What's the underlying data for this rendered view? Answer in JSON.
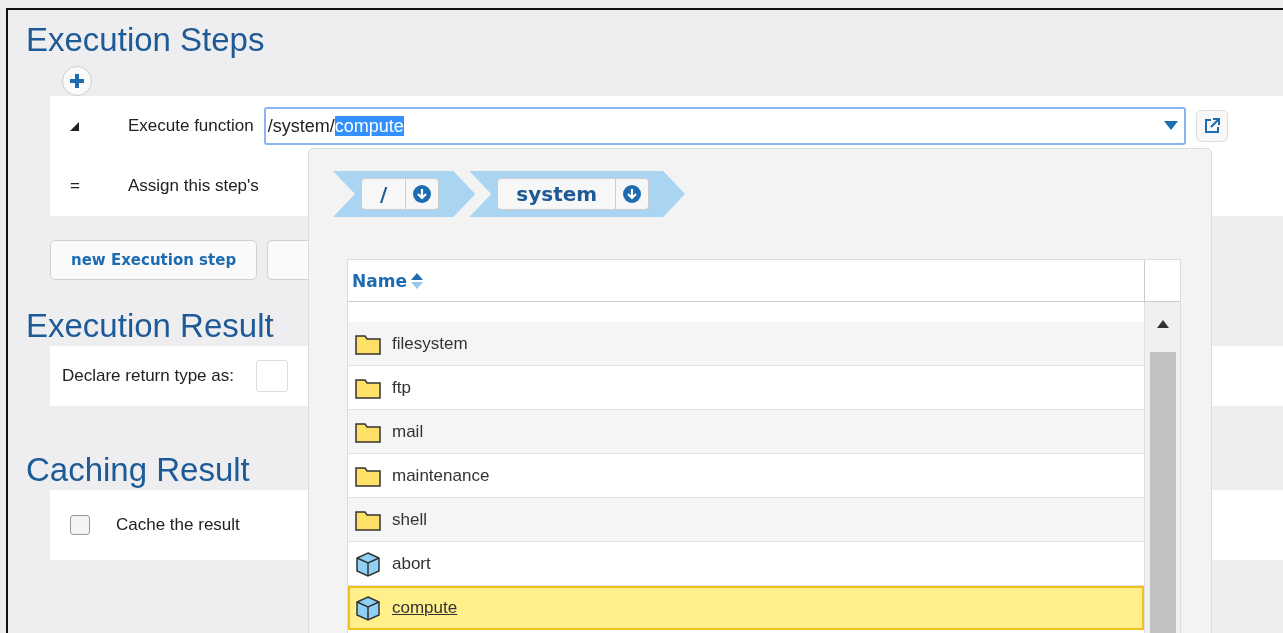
{
  "execution_steps": {
    "title": "Execution Steps",
    "steps": [
      {
        "kind": "function",
        "label": "Execute function",
        "value_prefix": "/system/",
        "value_selected": "compute"
      },
      {
        "kind": "assign",
        "marker": "=",
        "label": "Assign this step's"
      }
    ],
    "buttons": [
      "new Execution step"
    ]
  },
  "execution_result": {
    "title": "Execution Result",
    "label": "Declare return type as:"
  },
  "caching_result": {
    "title": "Caching Result",
    "checkbox": {
      "label": "Cache the result",
      "checked": false
    }
  },
  "browser": {
    "breadcrumbs": [
      {
        "label": "/"
      },
      {
        "label": "system"
      }
    ],
    "column": "Name",
    "items": [
      {
        "name": "filesystem",
        "kind": "folder",
        "selected": false
      },
      {
        "name": "ftp",
        "kind": "folder",
        "selected": false
      },
      {
        "name": "mail",
        "kind": "folder",
        "selected": false
      },
      {
        "name": "maintenance",
        "kind": "folder",
        "selected": false
      },
      {
        "name": "shell",
        "kind": "folder",
        "selected": false
      },
      {
        "name": "abort",
        "kind": "function",
        "selected": false
      },
      {
        "name": "compute",
        "kind": "function",
        "selected": true
      }
    ]
  }
}
